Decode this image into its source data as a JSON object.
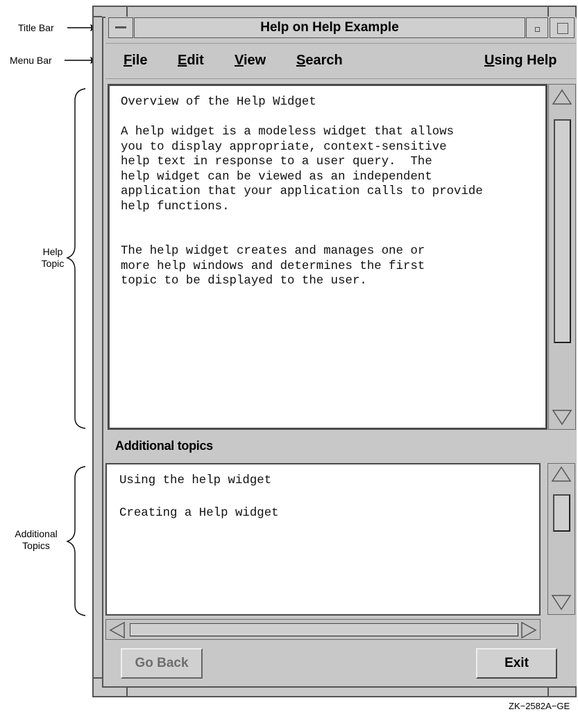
{
  "callouts": {
    "title_bar": "Title Bar",
    "menu_bar": "Menu Bar",
    "help_topic": [
      "Help",
      "Topic"
    ],
    "additional_topics": [
      "Additional",
      "Topics"
    ]
  },
  "window": {
    "title": "Help on Help Example",
    "menu": [
      {
        "label": "File",
        "mnemonic": "F",
        "rest": "ile"
      },
      {
        "label": "Edit",
        "mnemonic": "E",
        "rest": "dit"
      },
      {
        "label": "View",
        "mnemonic": "V",
        "rest": "iew"
      },
      {
        "label": "Search",
        "mnemonic": "S",
        "rest": "earch"
      },
      {
        "label": "Using Help",
        "mnemonic": "U",
        "rest": "sing Help"
      }
    ],
    "help_topic": {
      "heading": "Overview of the Help Widget",
      "paragraph1": [
        "A help widget is a modeless widget that allows",
        "you to display appropriate, context-sensitive",
        "help text in response to a user query.  The",
        "help widget can be viewed as an independent",
        "application that your application calls to provide",
        "help functions."
      ],
      "paragraph2": [
        "The help widget creates and manages one or",
        "more help windows and determines the first",
        "topic to be displayed to the user."
      ]
    },
    "additional_topics_label": "Additional topics",
    "additional_topics": [
      "Using the help widget",
      "Creating a Help widget"
    ],
    "buttons": {
      "go_back": "Go Back",
      "exit": "Exit"
    }
  },
  "figure_id": "ZK−2582A−GE"
}
